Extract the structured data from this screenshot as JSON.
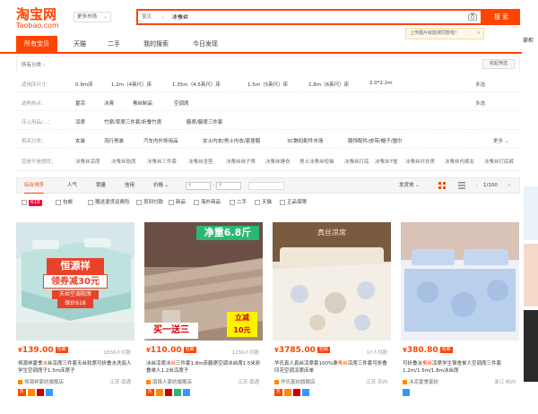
{
  "header": {
    "logo_cn": "淘宝网",
    "logo_en": "Taobao.com",
    "market": "更多市场",
    "scope": "宝贝",
    "query": "冰蚕丝",
    "search_button": "搜 索",
    "tooltip": "上传图片就能搜同款啦！",
    "right_edge_text": "掌柜"
  },
  "tabs": [
    "所有宝贝",
    "天猫",
    "二手",
    "我的搜索",
    "今日发现"
  ],
  "filters": {
    "all_category": "所有分类",
    "collapse_label": "收起筛选",
    "rows": [
      {
        "label": "适用床尺寸：",
        "options": [
          "0.9m床",
          "1.2m（4英尺）床",
          "1.35m（4.5英尺）床",
          "1.5m（5英尺）床",
          "1.8m（6英尺）床",
          "2.0*2.2m"
        ],
        "more": "多选"
      },
      {
        "label": "选购热点：",
        "options": [
          "夏凉",
          "冰爽",
          "蚕丝制品",
          "空调席"
        ],
        "more": "多选"
      },
      {
        "label": "床上用品/...：",
        "options": [
          "凉席",
          "竹席/草席三件套/折叠竹席",
          "藤席/藤席三件套"
        ],
        "more": ""
      },
      {
        "label": "相关分类：",
        "options": [
          "女装",
          "流行男装",
          "汽车内外饰用品",
          "女士内衣/男士内衣/家居服",
          "3C数码配件市场",
          "服饰配件/皮带/帽子/围巾"
        ],
        "more": "更多"
      },
      {
        "label": "您是不是想找：",
        "options": [
          "冰蚕丝凉席",
          "冰蚕丝软席",
          "冰蚕丝三件套",
          "冰蚕丝坐垫",
          "冰蚕丝袜子男",
          "冰蚕丝睡衣",
          "男士冰蚕丝短袖",
          "冰蚕丝打底",
          "冰蚕丝T恤",
          "冰蚕丝衬衣男",
          "冰蚕丝内裤女",
          "冰蚕丝打底裤"
        ],
        "more": ""
      }
    ]
  },
  "sort": {
    "items": [
      "综合排序",
      "人气",
      "销量",
      "信用",
      "价格"
    ],
    "price_from": "¥",
    "price_to": "¥",
    "ship_from": "发货地",
    "page": "1/100"
  },
  "checks": [
    {
      "label": "618",
      "badge": true
    },
    {
      "label": "包邮"
    },
    {
      "label": "赠送退货运费险"
    },
    {
      "label": "货到付款"
    },
    {
      "label": "新品"
    },
    {
      "label": "海外商品"
    },
    {
      "label": "二手"
    },
    {
      "label": "天猫"
    },
    {
      "label": "正品保障"
    }
  ],
  "products": [
    {
      "price": "139.00",
      "tag": "包邮",
      "sold": "1830人付款",
      "title_pre": "恒源祥夏季",
      "title_hl": "冰",
      "title_post": "丝凉席三件套天丝软席可折叠水洗双人学生空调席子1.5m床席子",
      "shop": "恒源祥家纺旗舰店",
      "loc": "江苏 南通",
      "img_text1": "恒源祥",
      "img_text2": "领券减30元",
      "img_text3": "天丝空调软席",
      "img_text4": "保价618"
    },
    {
      "price": "110.00",
      "tag": "包邮",
      "sold": "1230人付款",
      "title_pre": "冰丝凉席冰",
      "title_hl": "丝",
      "title_post": "三件套1.8m床藤席空调冰丝席1.5米折叠单人1.2米凉席子",
      "shop": "南极人家纺旗舰店",
      "loc": "江苏 南通",
      "img_text1": "净重6.8斤",
      "img_text2": "买一送三",
      "img_text3": "立减",
      "img_text4": "10元"
    },
    {
      "price": "3785.00",
      "tag": "包邮",
      "sold": "17人付款",
      "title_pre": "华氏真人真丝凉席套100%桑",
      "title_hl": "蚕丝",
      "title_post": "凉席三件套可折叠印花空调凉席床单",
      "shop": "华氏家纺旗舰店",
      "loc": "江苏 苏州",
      "img_text1": "真丝凉席",
      "img_text2": "",
      "img_text3": "",
      "img_text4": ""
    },
    {
      "price": "380.80",
      "tag": "包邮",
      "sold": "",
      "title_pre": "可折叠冰",
      "title_hl": "蚕丝",
      "title_post": "凉席学生宿舍单人空调席三件套1.2m/1.5m/1.8m冰丝席",
      "shop": "冰凉夏季家纺",
      "loc": "浙江 杭州",
      "img_text1": "",
      "img_text2": "",
      "img_text3": "",
      "img_text4": ""
    }
  ],
  "colors": {
    "brand": "#ff4400",
    "tmall": "#ff0036"
  }
}
